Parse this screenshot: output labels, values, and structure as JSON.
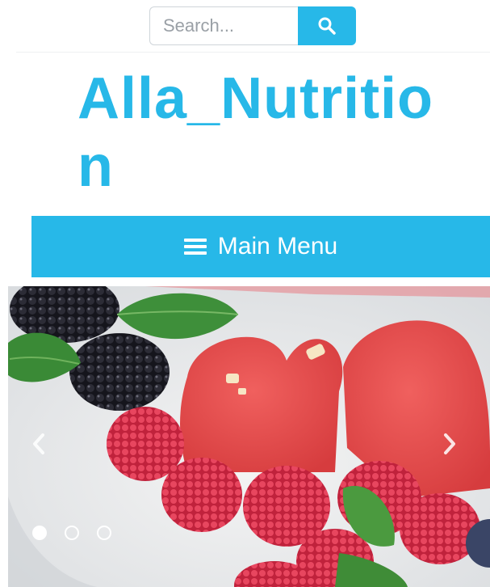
{
  "search": {
    "placeholder": "Search...",
    "icon": "search-icon"
  },
  "site": {
    "title": "Alla_Nutrition"
  },
  "menu": {
    "label": "Main Menu",
    "icon": "hamburger-icon"
  },
  "slider": {
    "image": "fruit-hearts-photo",
    "prev_icon": "chevron-left-icon",
    "next_icon": "chevron-right-icon",
    "slide_count": 3,
    "active_slide": 1
  },
  "colors": {
    "accent": "#27b8e8",
    "background": "#ffffff"
  }
}
